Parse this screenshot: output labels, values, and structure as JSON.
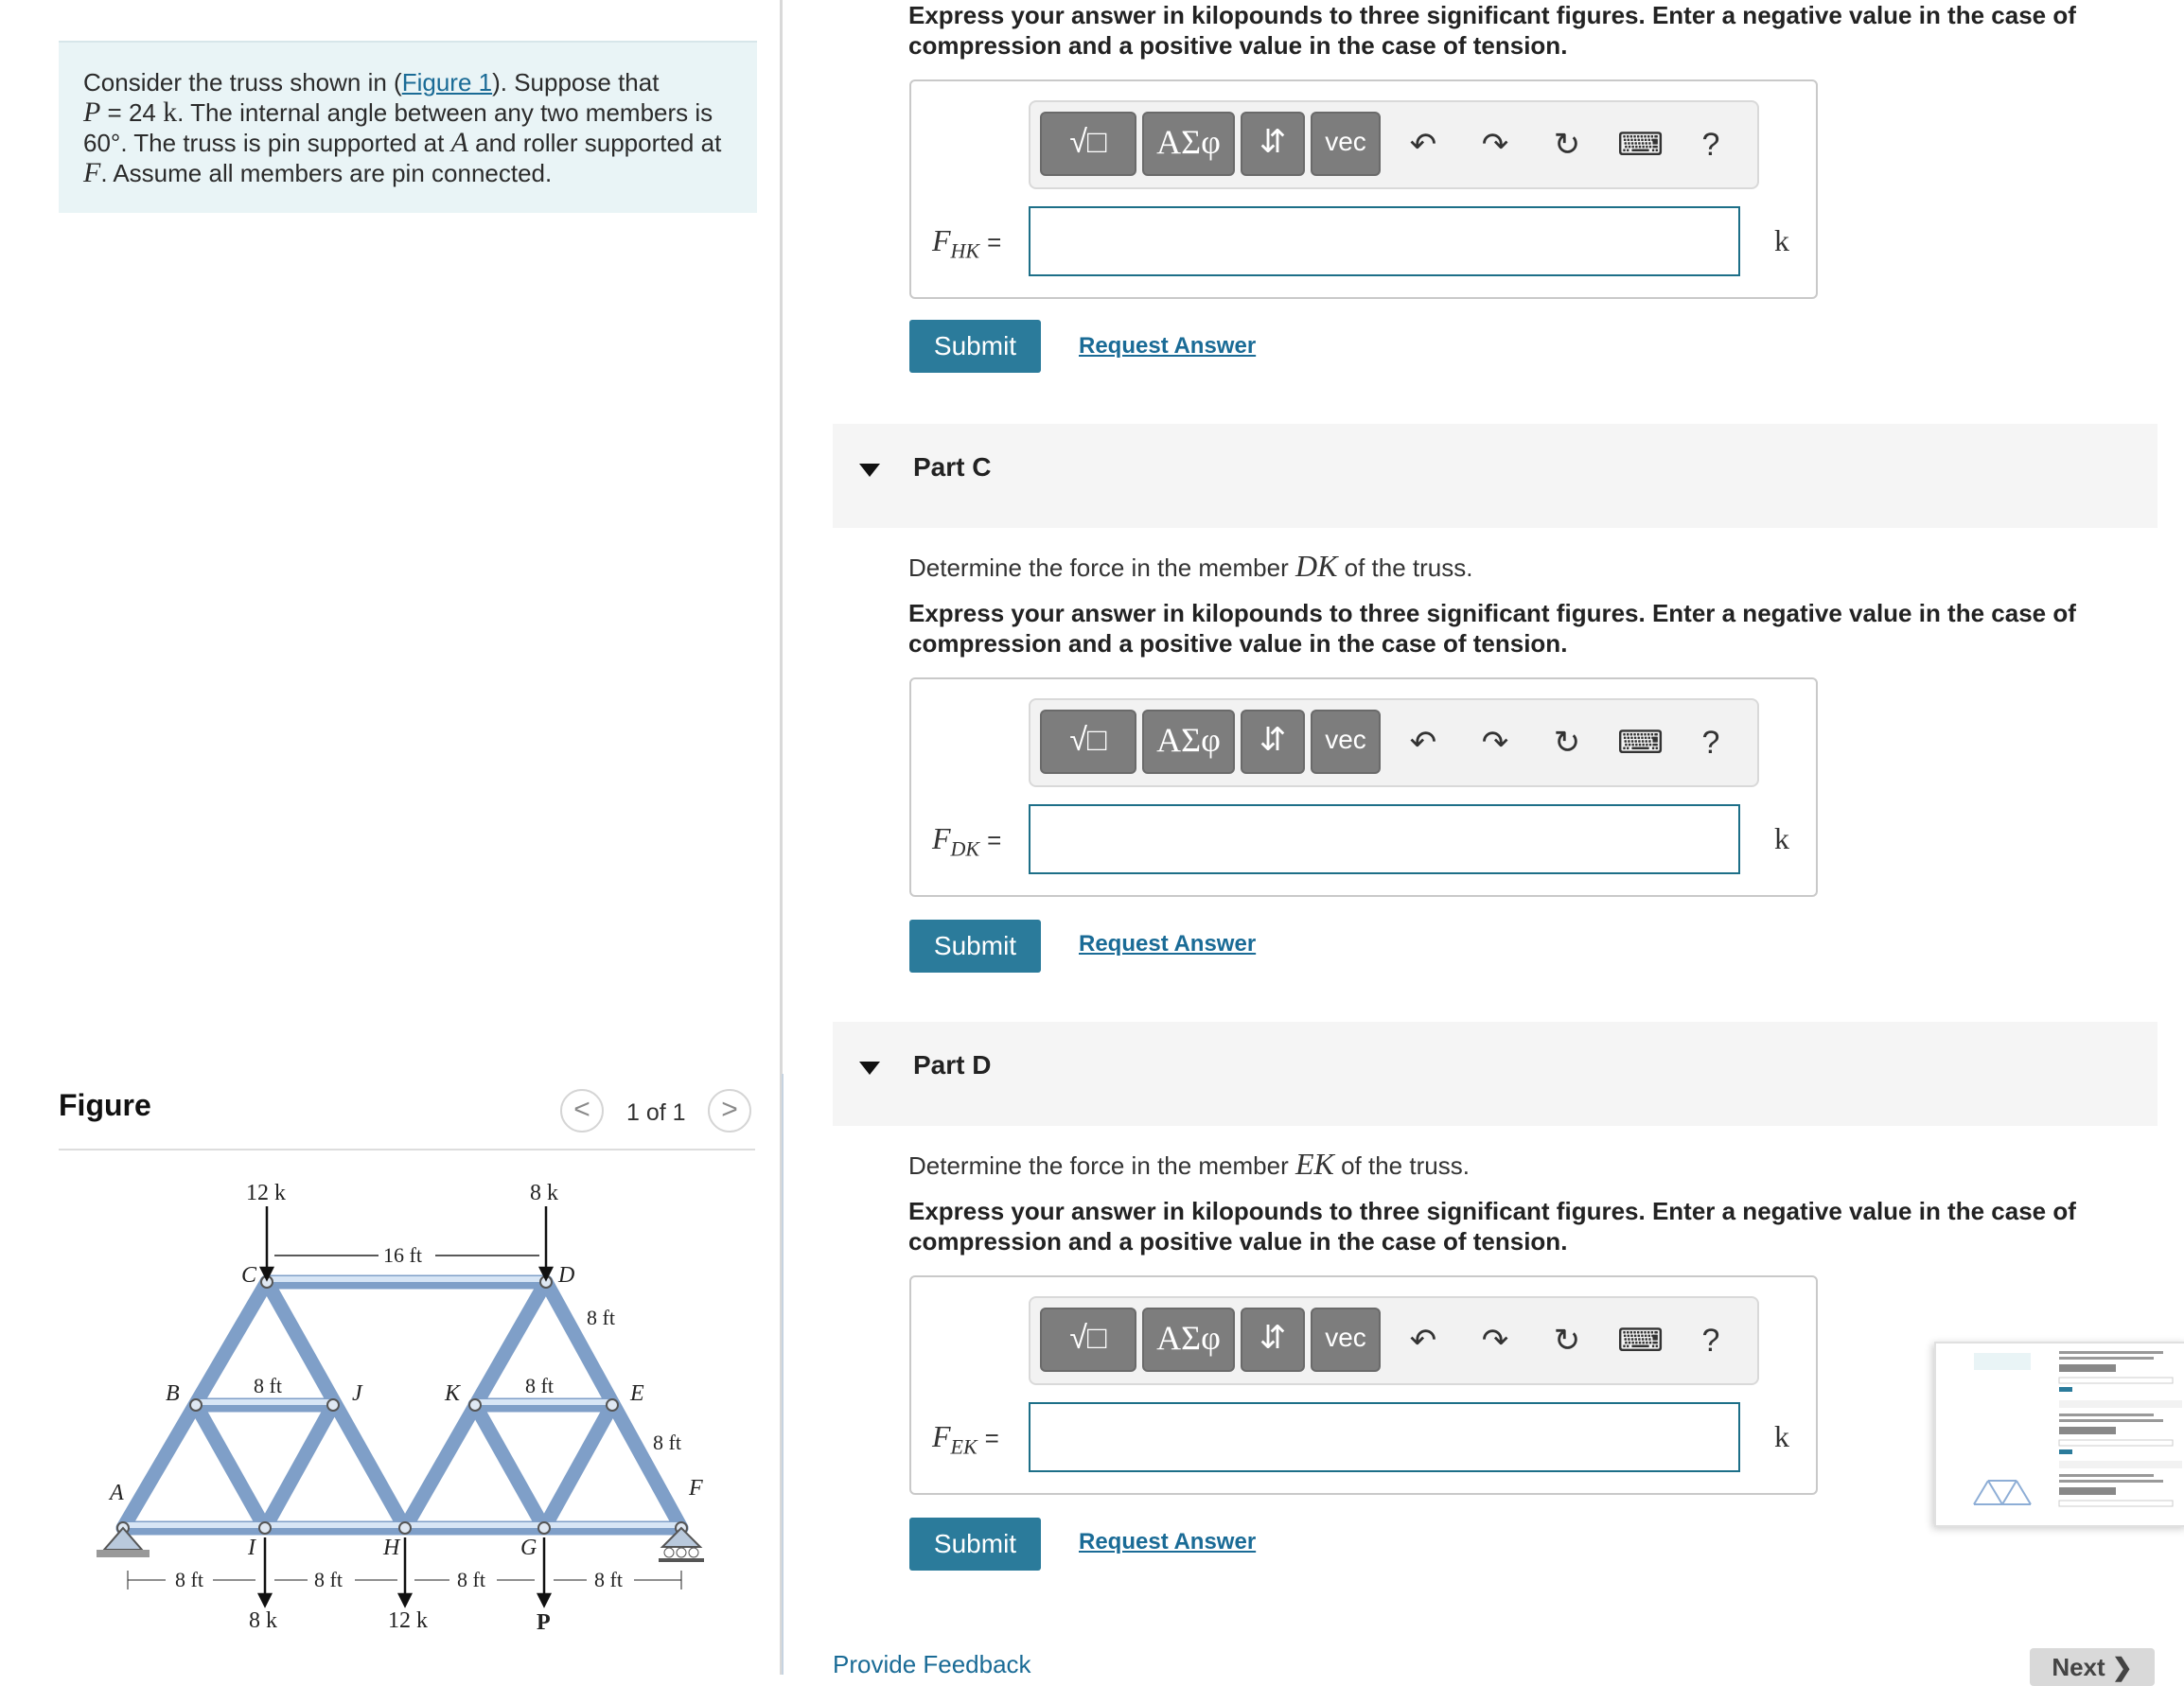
{
  "problem": {
    "text_intro": "Consider the truss shown in (",
    "figure_link": "Figure 1",
    "text_a": "). Suppose that",
    "var_p": "P",
    "eq_p": " = 24 ",
    "unit_k": "k",
    "text_b": ". The internal angle between any two members is 60°. The truss is pin supported at ",
    "var_a": "A",
    "text_c": " and roller supported at ",
    "var_f": "F",
    "text_d": ". Assume all members are pin connected."
  },
  "figure": {
    "title": "Figure",
    "pager": "1 of 1",
    "prev": "<",
    "next": ">",
    "loads": [
      "12 k",
      "8 k",
      "8 k",
      "12 k",
      "P"
    ],
    "dims": [
      "16 ft",
      "8 ft",
      "8 ft",
      "8 ft",
      "8 ft",
      "8 ft",
      "8 ft",
      "8 ft",
      "8 ft"
    ],
    "nodes": [
      "A",
      "B",
      "C",
      "D",
      "E",
      "F",
      "G",
      "H",
      "I",
      "J",
      "K"
    ]
  },
  "toolbar": {
    "templates": "√□",
    "greek": "ΑΣφ",
    "arrows": "⇵",
    "vec": "vec",
    "undo": "↶",
    "redo": "↷",
    "reset": "↻",
    "keyboard": "⌨",
    "help": "?"
  },
  "instruction": "Express your answer in kilopounds to three significant figures. Enter a negative value in the case of compression and a positive value in the case of tension.",
  "part_b": {
    "var": "F",
    "sub": "HK",
    "eq": "=",
    "unit": "k",
    "submit": "Submit",
    "request": "Request Answer"
  },
  "part_c": {
    "title": "Part C",
    "question_pre": "Determine the force in the member ",
    "member": "DK",
    "question_post": " of the truss.",
    "var": "F",
    "sub": "DK",
    "eq": "=",
    "unit": "k",
    "submit": "Submit",
    "request": "Request Answer"
  },
  "part_d": {
    "title": "Part D",
    "question_pre": "Determine the force in the member ",
    "member": "EK",
    "question_post": " of the truss.",
    "var": "F",
    "sub": "EK",
    "eq": "=",
    "unit": "k",
    "submit": "Submit",
    "request": "Request Answer"
  },
  "footer": {
    "feedback": "Provide Feedback",
    "next": "Next ❯"
  }
}
